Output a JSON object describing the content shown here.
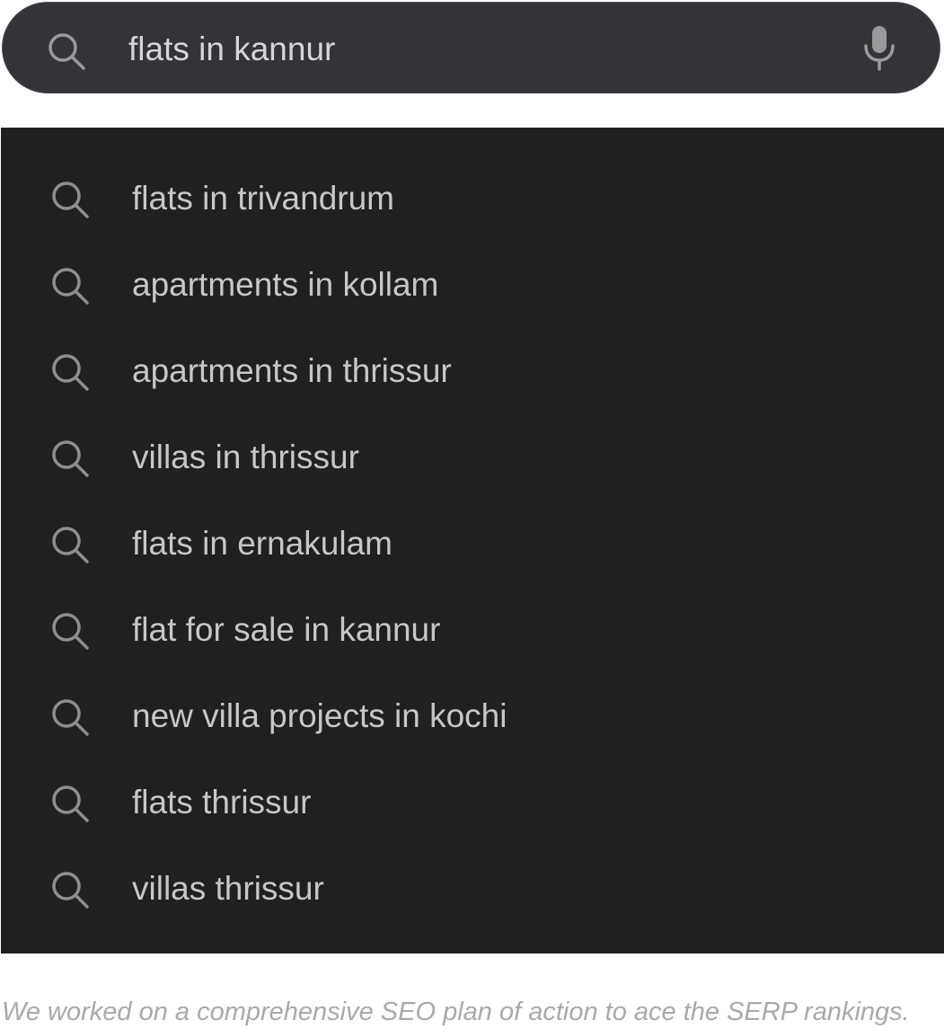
{
  "search": {
    "query": "flats in kannur",
    "icons": {
      "search": "search-icon",
      "voice": "microphone-icon"
    }
  },
  "suggestions": [
    {
      "label": "flats in trivandrum",
      "icon": "search-icon"
    },
    {
      "label": "apartments in kollam",
      "icon": "search-icon"
    },
    {
      "label": "apartments in thrissur",
      "icon": "search-icon"
    },
    {
      "label": "villas in thrissur",
      "icon": "search-icon"
    },
    {
      "label": "flats in ernakulam",
      "icon": "search-icon"
    },
    {
      "label": "flat for sale in kannur",
      "icon": "search-icon"
    },
    {
      "label": "new villa projects in kochi",
      "icon": "search-icon"
    },
    {
      "label": "flats thrissur",
      "icon": "search-icon"
    },
    {
      "label": "villas thrissur",
      "icon": "search-icon"
    }
  ],
  "caption": "We worked on a comprehensive SEO plan of action to ace the SERP rankings.",
  "colors": {
    "search_bar_bg": "#333438",
    "dropdown_bg": "#202020",
    "suggestion_text": "#c7c7c7",
    "icon": "#8e8e8e",
    "caption_text": "#a9a9a9"
  }
}
